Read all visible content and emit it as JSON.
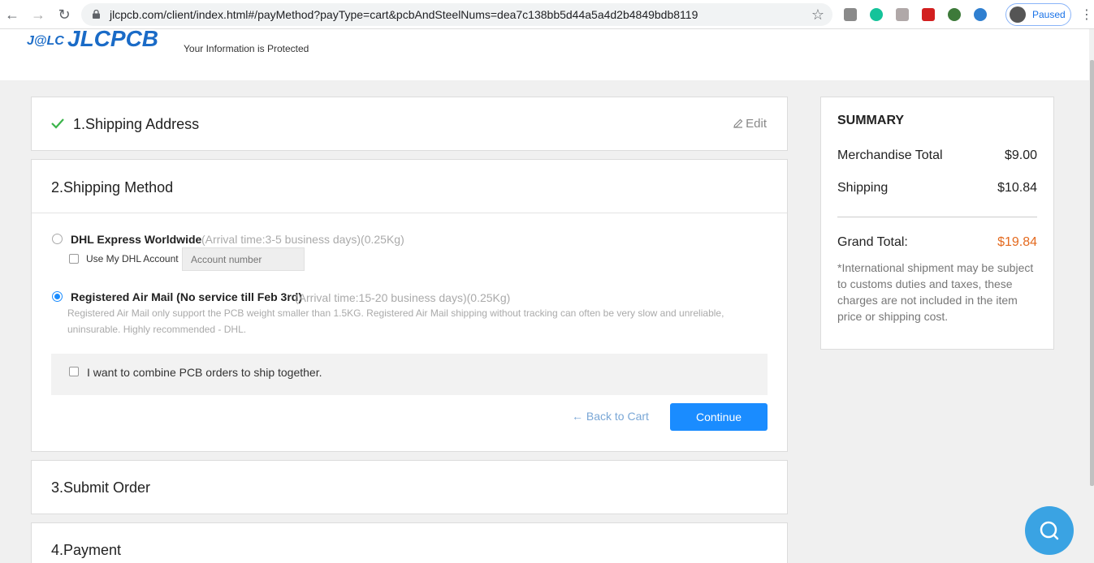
{
  "browser": {
    "url": "jlcpcb.com/client/index.html#/payMethod?payType=cart&pcbAndSteelNums=dea7c138bb5d44a5a4d2b4849bdb8119",
    "profile_status": "Paused"
  },
  "header": {
    "logo_mark": "J@LC",
    "logo_text": "JLCPCB",
    "protected_text": "Your Information is Protected"
  },
  "sections": {
    "shipping_address": {
      "title": "1.Shipping Address",
      "edit_label": "Edit"
    },
    "shipping_method": {
      "title": "2.Shipping Method",
      "options": [
        {
          "name": "DHL Express Worldwide",
          "note": "(Arrival time:3-5 business days)(0.25Kg)",
          "selected": false
        },
        {
          "name": "Registered Air Mail (No service till Feb 3rd)",
          "note": "(Arrival time:15-20 business days)(0.25Kg)",
          "selected": true
        }
      ],
      "dhl_account_label": "Use My DHL Account",
      "dhl_account_placeholder": "Account number",
      "airmail_description": "Registered Air Mail only support the PCB weight smaller than 1.5KG. Registered Air Mail shipping without tracking can often be very slow and unreliable, uninsurable. Highly recommended - DHL.",
      "combine_label": "I want to combine PCB orders to ship together.",
      "back_label": "Back to Cart",
      "continue_label": "Continue"
    },
    "submit_order": {
      "title": "3.Submit Order"
    },
    "payment": {
      "title": "4.Payment"
    }
  },
  "summary": {
    "title": "SUMMARY",
    "merchandise_label": "Merchandise Total",
    "merchandise_value": "$9.00",
    "shipping_label": "Shipping",
    "shipping_value": "$10.84",
    "grand_label": "Grand Total:",
    "grand_value": "$19.84",
    "note": "*International shipment may be subject to customs duties and taxes, these charges are not included in the item price or shipping cost."
  },
  "colors": {
    "accent": "#1a8cff",
    "grand_total": "#e46a1f",
    "check": "#3cb44b"
  }
}
